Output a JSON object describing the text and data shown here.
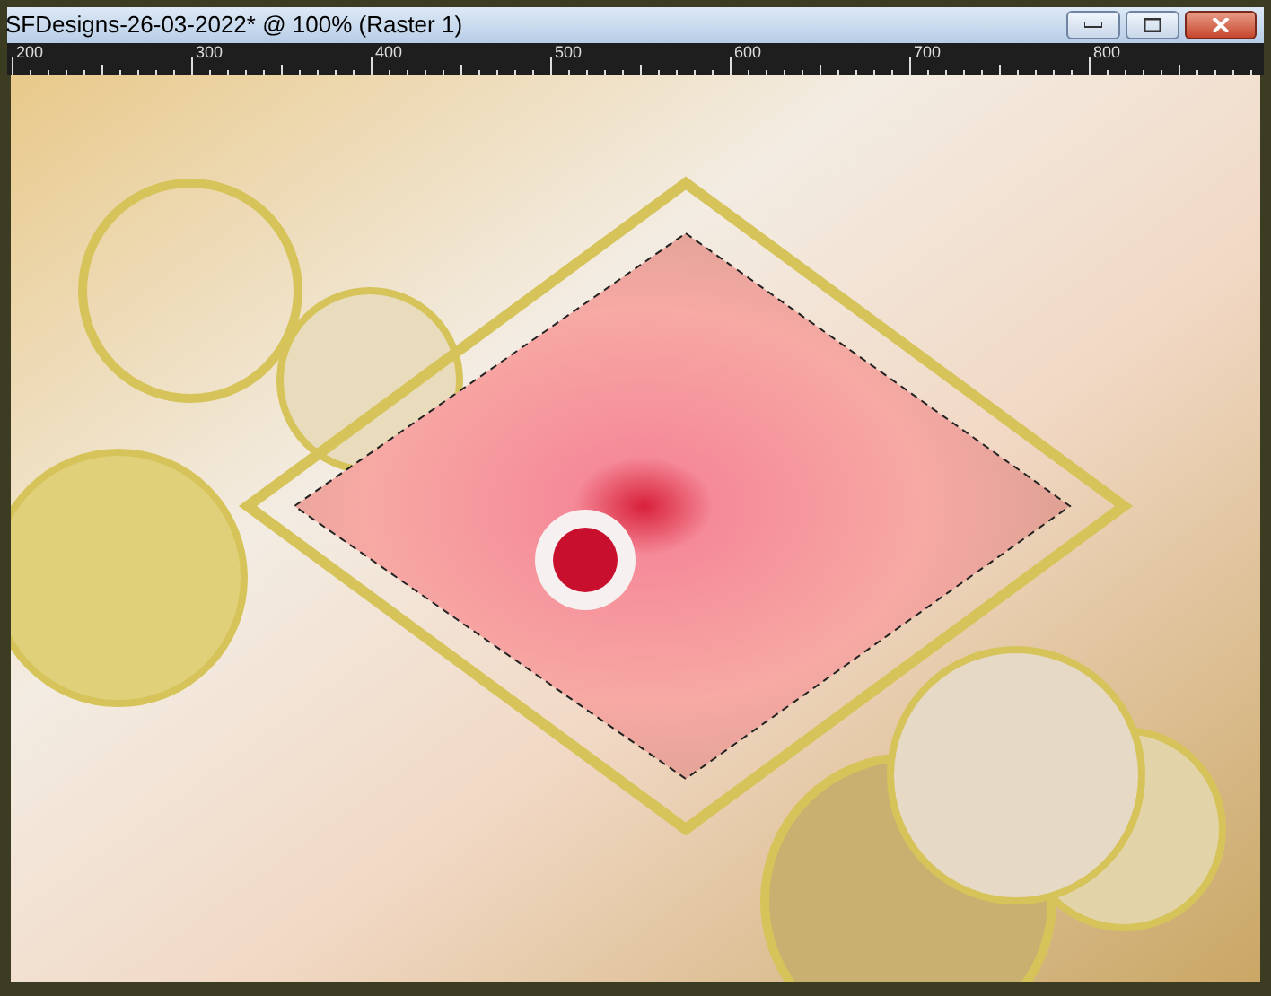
{
  "window": {
    "title": "SFDesigns-26-03-2022* @ 100% (Raster 1)"
  },
  "ruler": {
    "labels": [
      "200",
      "300",
      "400",
      "500",
      "600",
      "700",
      "800"
    ]
  }
}
